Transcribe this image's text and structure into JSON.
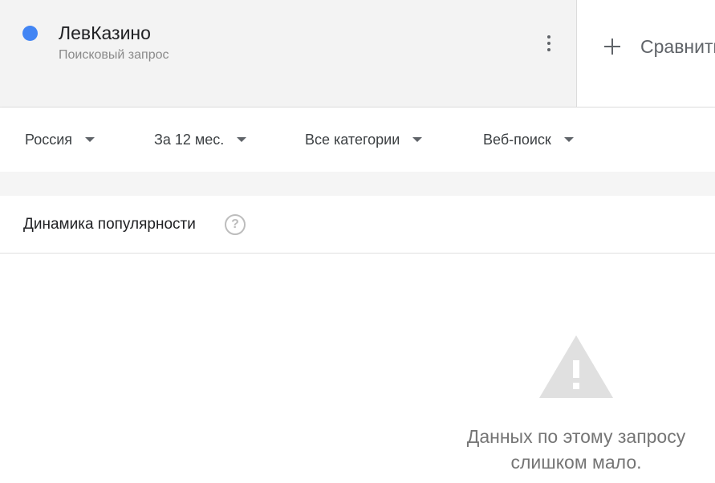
{
  "term": {
    "name": "ЛевКазино",
    "subtitle": "Поисковый запрос",
    "dot_color": "#4285f4",
    "menu_icon": "more-vert-icon"
  },
  "compare": {
    "icon": "plus-icon",
    "label": "Сравнить"
  },
  "filters": [
    {
      "label": "Россия"
    },
    {
      "label": "За 12 мес."
    },
    {
      "label": "Все категории"
    },
    {
      "label": "Веб-поиск"
    }
  ],
  "popularity": {
    "title": "Динамика популярности",
    "help_icon": "help-circle-icon",
    "warning_icon": "warning-triangle-icon",
    "message_line1": "Данных по этому запросу",
    "message_line2": "слишком мало."
  },
  "colors": {
    "term_dot": "#4285f4",
    "warning_icon": "#e0e0e0"
  }
}
